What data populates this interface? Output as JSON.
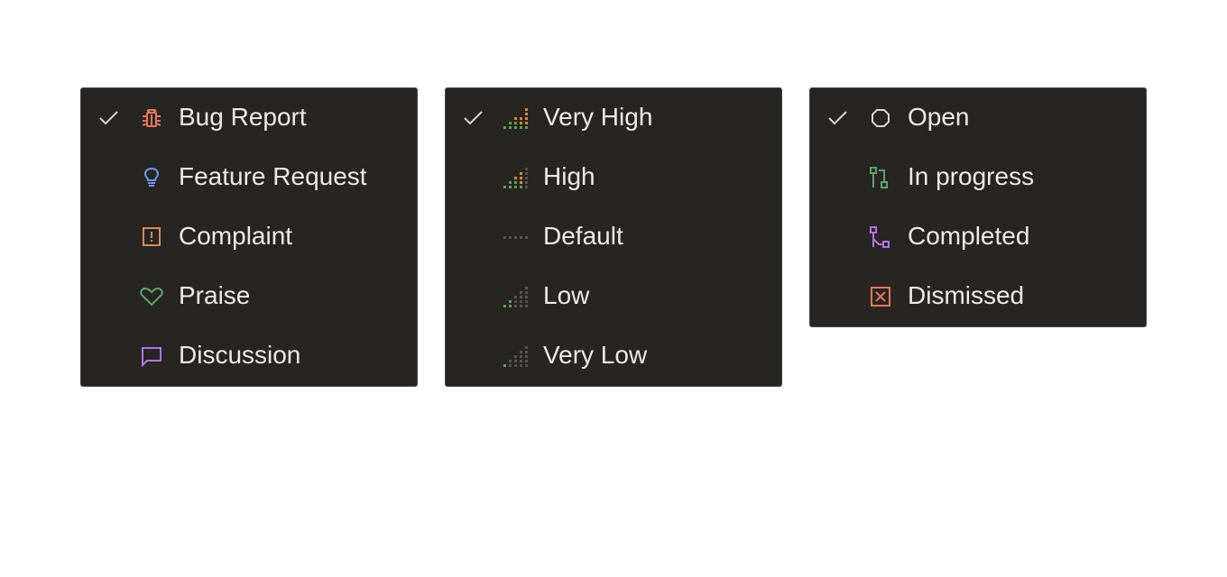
{
  "colors": {
    "menu_bg": "#262522",
    "menu_border": "#45443f",
    "text": "#ecebe6",
    "check": "#d8d7d2",
    "bug": "#e8755a",
    "feature": "#6f95e8",
    "complaint": "#d98a55",
    "praise": "#5aa566",
    "discussion": "#b670e6",
    "priority_on_green": "#5f9f4c",
    "priority_on_orange": "#e0872f",
    "priority_off": "#56544f",
    "status_open": "#d8d7d2",
    "status_in_progress": "#5aa566",
    "status_completed": "#b670e6",
    "status_dismissed": "#e8755a"
  },
  "type_menu": {
    "items": [
      {
        "label": "Bug Report",
        "icon": "bug-icon",
        "selected": true
      },
      {
        "label": "Feature Request",
        "icon": "lightbulb-icon",
        "selected": false
      },
      {
        "label": "Complaint",
        "icon": "alert-square-icon",
        "selected": false
      },
      {
        "label": "Praise",
        "icon": "heart-icon",
        "selected": false
      },
      {
        "label": "Discussion",
        "icon": "speech-bubble-icon",
        "selected": false
      }
    ]
  },
  "priority_menu": {
    "items": [
      {
        "label": "Very High",
        "icon": "priority-very-high-icon",
        "level": 4,
        "selected": true
      },
      {
        "label": "High",
        "icon": "priority-high-icon",
        "level": 3,
        "selected": false
      },
      {
        "label": "Default",
        "icon": "priority-default-icon",
        "level": 0,
        "selected": false
      },
      {
        "label": "Low",
        "icon": "priority-low-icon",
        "level": 2,
        "selected": false
      },
      {
        "label": "Very Low",
        "icon": "priority-very-low-icon",
        "level": 1,
        "selected": false
      }
    ]
  },
  "status_menu": {
    "items": [
      {
        "label": "Open",
        "icon": "circle-icon",
        "selected": true
      },
      {
        "label": "In progress",
        "icon": "branch-in-progress-icon",
        "selected": false
      },
      {
        "label": "Completed",
        "icon": "branch-completed-icon",
        "selected": false
      },
      {
        "label": "Dismissed",
        "icon": "x-square-icon",
        "selected": false
      }
    ]
  }
}
